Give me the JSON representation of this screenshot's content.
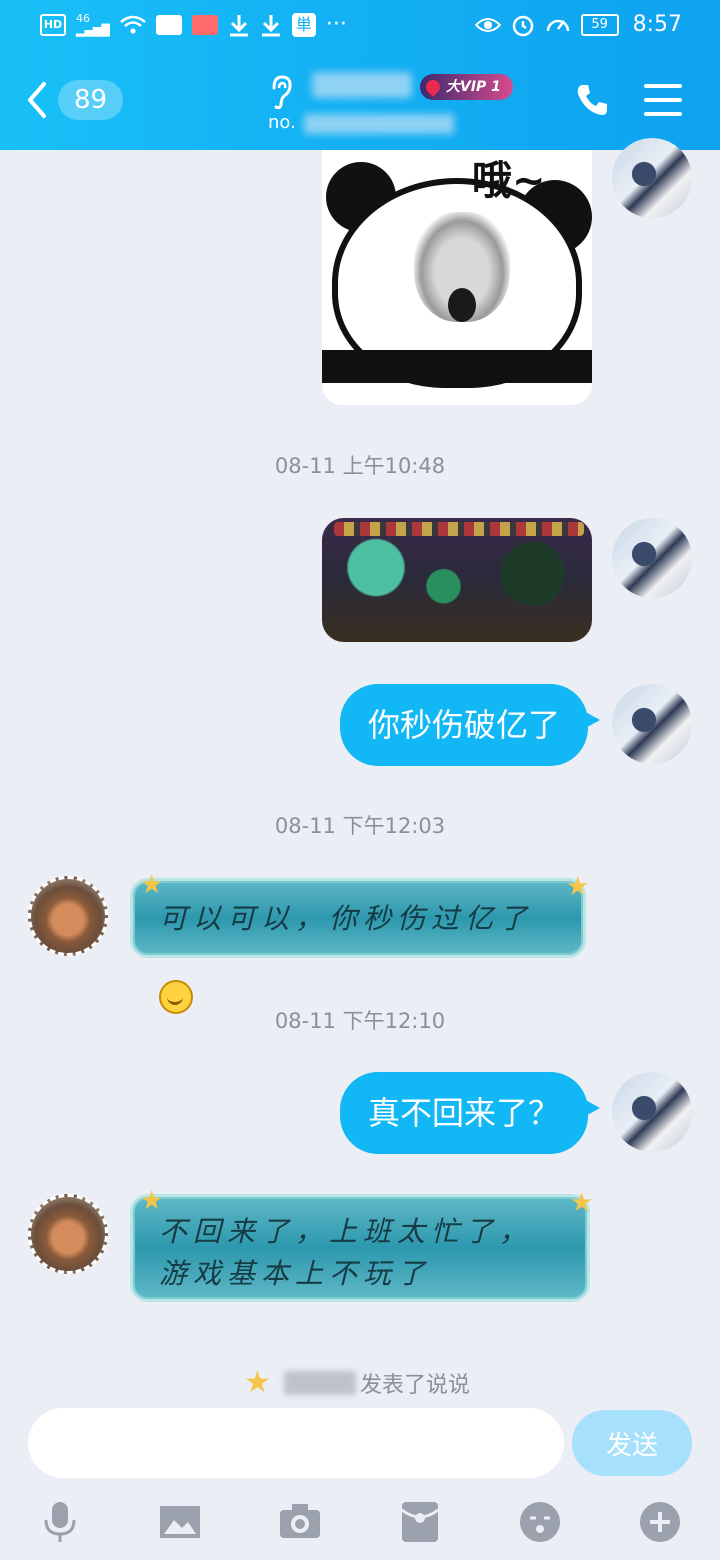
{
  "status_bar": {
    "left_text": "HD",
    "signal_text": "46",
    "battery": "59",
    "time": "8:57"
  },
  "header": {
    "unread_count": "89",
    "contact_id_prefix": "no.",
    "vip_label": "大VIP 1"
  },
  "messages": {
    "meme_caption": "哦~",
    "ts1": "08-11 上午10:48",
    "msg_right_1": "你秒伤破亿了",
    "ts2": "08-11 下午12:03",
    "msg_left_1": "可以可以，你秒伤过亿了",
    "ts3": "08-11 下午12:10",
    "msg_right_2": "真不回来了？",
    "msg_left_2": "不回来了，上班太忙了，游戏基本上不玩了"
  },
  "feed_note": "发表了说说",
  "input": {
    "placeholder": "",
    "send_label": "发送"
  },
  "colors": {
    "header_blue": "#12aef3",
    "bubble_blue": "#12b7f5",
    "send_disabled": "#a6e0fb"
  },
  "toolbar_icons": [
    "microphone-icon",
    "image-icon",
    "camera-icon",
    "red-packet-icon",
    "emoji-icon",
    "plus-icon"
  ]
}
